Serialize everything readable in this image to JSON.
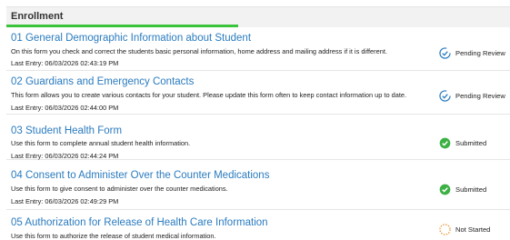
{
  "section": {
    "title": "Enrollment",
    "progress": 0.46
  },
  "forms": [
    {
      "title": "01 General Demographic Information about Student",
      "description": "On this form you check and correct the students basic personal information, home address and mailing address if it is different.",
      "last_entry": "Last Entry: 06/03/2026 02:43:19 PM",
      "status": "Pending Review",
      "status_icon": "pending-review-icon"
    },
    {
      "title": "02 Guardians and Emergency Contacts",
      "description": "This form allows you to create various contacts for your student. Please update this form often to keep contact information up to date.",
      "last_entry": "Last Entry: 06/03/2026 02:44:00 PM",
      "status": "Pending Review",
      "status_icon": "pending-review-icon"
    },
    {
      "title": "03 Student Health Form",
      "description": "Use this form to complete annual student health information.",
      "last_entry": "Last Entry: 06/03/2026 02:44:24 PM",
      "status": "Submitted",
      "status_icon": "submitted-check-icon"
    },
    {
      "title": "04 Consent to Administer Over the Counter Medications",
      "description": "Use this form to give consent to administer over the counter medications.",
      "last_entry": "Last Entry: 06/03/2026 02:49:29 PM",
      "status": "Submitted",
      "status_icon": "submitted-check-icon"
    },
    {
      "title": "05 Authorization for Release of Health Care Information",
      "description": "Use this form to authorize the release of student medical information.",
      "status": "Not Started",
      "status_icon": "not-started-icon"
    }
  ],
  "colors": {
    "link": "#2a7bbf",
    "progress": "#3cc33c",
    "pending": "#2a7bbf",
    "submitted": "#3cb043",
    "not_started": "#e8912c"
  }
}
